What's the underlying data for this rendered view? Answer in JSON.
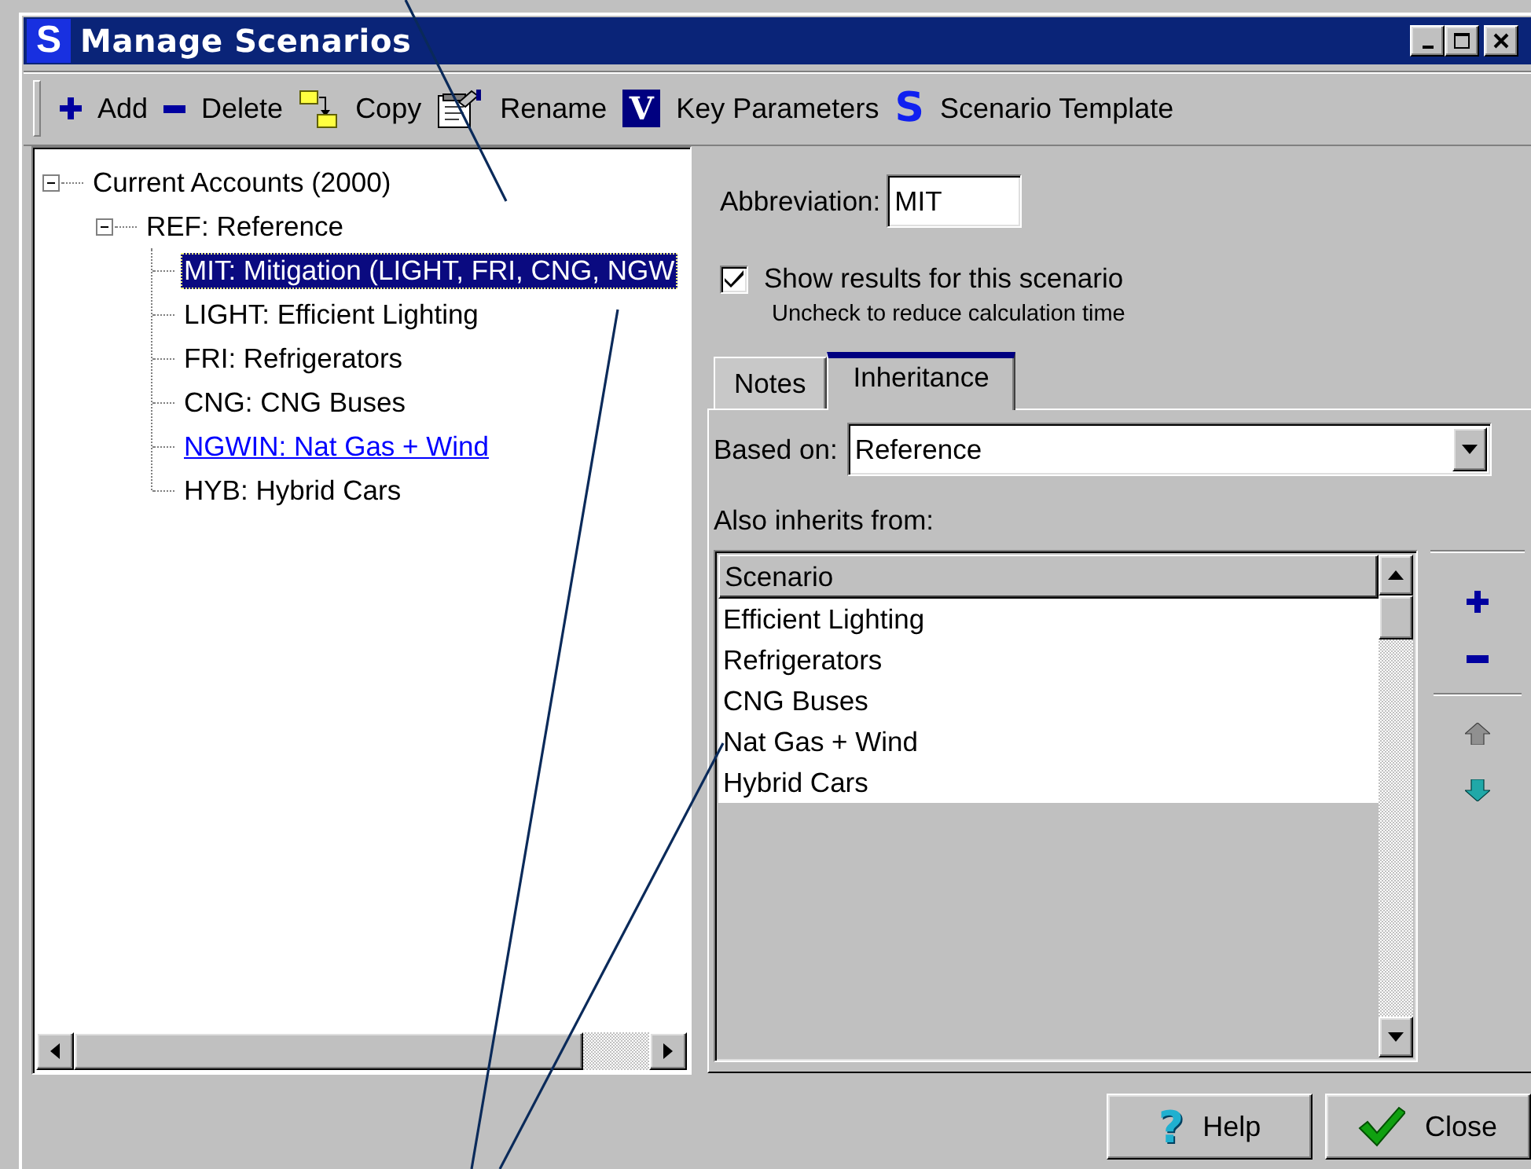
{
  "window": {
    "title": "Manage Scenarios",
    "icon_glyph": "S"
  },
  "toolbar": [
    {
      "label": "Add"
    },
    {
      "label": "Delete"
    },
    {
      "label": "Copy"
    },
    {
      "label": "Rename"
    },
    {
      "label": "Key Parameters",
      "glyph": "V"
    },
    {
      "label": "Scenario Template",
      "glyph": "S"
    }
  ],
  "tree": {
    "items": [
      {
        "label": "Current Accounts (2000)",
        "selected": false,
        "expanded": true,
        "children": [
          {
            "label": "REF: Reference",
            "selected": false,
            "expanded": true,
            "children": [
              {
                "label": "MIT: Mitigation (LIGHT, FRI, CNG, NGW",
                "selected": true,
                "hovered": false
              },
              {
                "label": "LIGHT: Efficient Lighting",
                "selected": false,
                "hovered": false
              },
              {
                "label": "FRI: Refrigerators",
                "selected": false,
                "hovered": false
              },
              {
                "label": "CNG: CNG Buses",
                "selected": false,
                "hovered": false
              },
              {
                "label": "NGWIN: Nat Gas + Wind",
                "selected": false,
                "hovered": true
              },
              {
                "label": "HYB: Hybrid Cars",
                "selected": false,
                "hovered": false
              }
            ]
          }
        ]
      }
    ]
  },
  "abbreviation": {
    "label": "Abbreviation:",
    "value": "MIT"
  },
  "show_results": {
    "label": "Show results for this scenario",
    "checked": true,
    "hint": "Uncheck to reduce calculation time"
  },
  "tabs": [
    {
      "label": "Notes",
      "selected": false
    },
    {
      "label": "Inheritance",
      "selected": true
    }
  ],
  "based_on": {
    "label": "Based on:",
    "value": "Reference"
  },
  "inherits": {
    "label": "Also inherits from:",
    "columns": [
      "Scenario"
    ],
    "rows": [
      "Efficient Lighting",
      "Refrigerators",
      "CNG Buses",
      "Nat Gas + Wind",
      "Hybrid Cars"
    ]
  },
  "side_buttons": [
    {
      "disabled": false
    },
    {
      "disabled": false
    },
    {
      "disabled": true
    },
    {
      "disabled": false
    }
  ],
  "buttons": [
    {
      "label": "Help",
      "glyph": "?"
    },
    {
      "label": "Close"
    }
  ]
}
